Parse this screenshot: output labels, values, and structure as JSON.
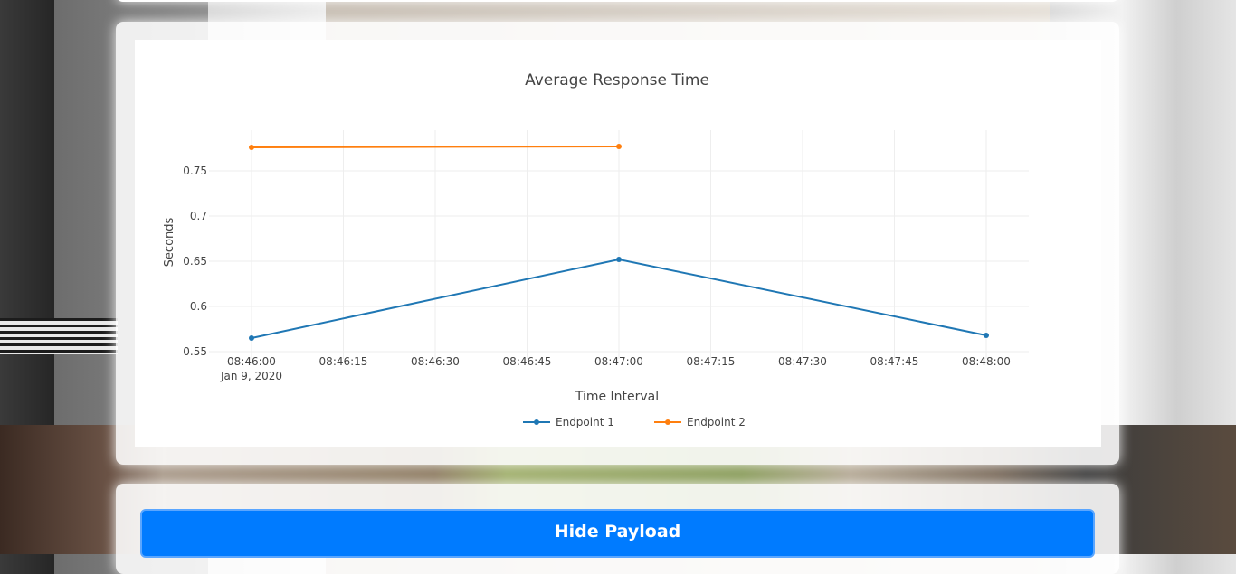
{
  "chart_data": {
    "type": "line",
    "title": "Average Response Time",
    "xlabel": "Time Interval",
    "ylabel": "Seconds",
    "x_ticks": [
      "08:46:00",
      "08:46:15",
      "08:46:30",
      "08:46:45",
      "08:47:00",
      "08:47:15",
      "08:47:30",
      "08:47:45",
      "08:48:00"
    ],
    "x_tick_sublabel": "Jan 9, 2020",
    "y_ticks": [
      0.55,
      0.6,
      0.65,
      0.7,
      0.75
    ],
    "ylim": [
      0.542,
      0.795
    ],
    "xlim": [
      "08:46:00",
      "08:48:00"
    ],
    "grid": true,
    "legend_position": "bottom-center",
    "series": [
      {
        "name": "Endpoint 1",
        "color": "#1f77b4",
        "x": [
          "08:46:00",
          "08:47:00",
          "08:48:00"
        ],
        "y": [
          0.565,
          0.652,
          0.568
        ]
      },
      {
        "name": "Endpoint 2",
        "color": "#ff7f0e",
        "x": [
          "08:46:00",
          "08:47:00"
        ],
        "y": [
          0.776,
          0.777
        ]
      }
    ]
  },
  "payload_button": {
    "label": "Hide Payload"
  }
}
